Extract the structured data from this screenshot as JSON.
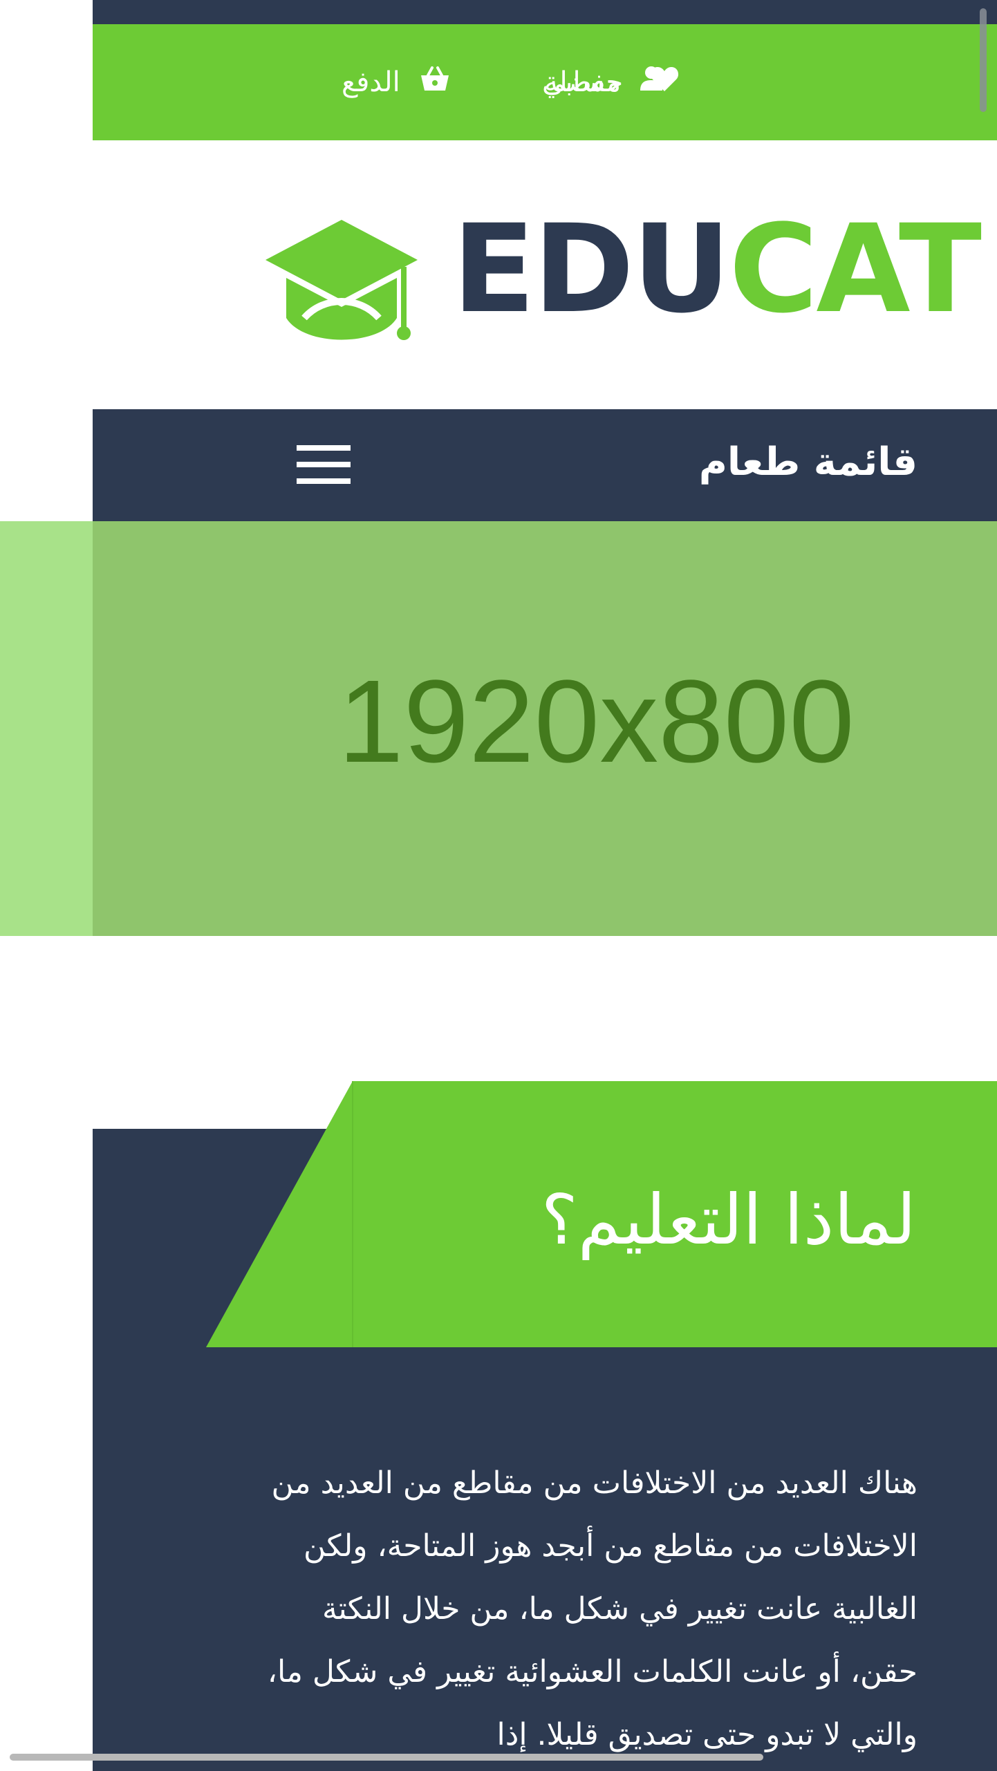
{
  "top_bar": {
    "account": {
      "label": "حسابي",
      "icon": "user-icon"
    },
    "wishlist": {
      "label": "مفضلة",
      "icon": "heart-icon"
    },
    "checkout": {
      "label": "الدفع",
      "icon": "basket-icon"
    }
  },
  "logo": {
    "part_dark": "EDU",
    "part_green": "CAT",
    "icon": "graduation-cap-icon"
  },
  "menu": {
    "title": "قائمة طعام",
    "toggle_icon": "hamburger-icon"
  },
  "hero": {
    "placeholder_text": "1920x800"
  },
  "why_section": {
    "title": "لماذا التعليم؟",
    "paragraph": "هناك العديد من الاختلافات من مقاطع من العديد من الاختلافات من مقاطع من أبجد هوز المتاحة، ولكن الغالبية عانت تغيير في شكل ما، من خلال النكتة حقن، أو عانت الكلمات العشوائية تغيير في شكل ما، والتي لا تبدو حتى تصديق قليلا. إذا"
  },
  "colors": {
    "navy": "#2d3a51",
    "green": "#6dcb35",
    "hero_bg": "#8fc56c",
    "hero_side": "#a8e289",
    "hero_text": "#437a1d",
    "white": "#ffffff"
  }
}
